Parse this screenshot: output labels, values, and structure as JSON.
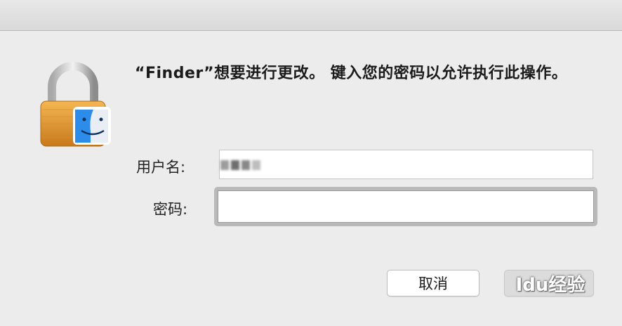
{
  "dialog": {
    "message": "“Finder”想要进行更改。 键入您的密码以允许执行此操作。",
    "fields": {
      "username_label": "用户名:",
      "username_value": "",
      "password_label": "密码:",
      "password_value": ""
    },
    "buttons": {
      "cancel_label": "取消"
    },
    "watermark": "Idu经验"
  },
  "icons": {
    "lock": "lock-icon",
    "finder": "finder-icon"
  },
  "colors": {
    "lock_gold": "#e39a2b",
    "finder_blue": "#2d8cea"
  }
}
